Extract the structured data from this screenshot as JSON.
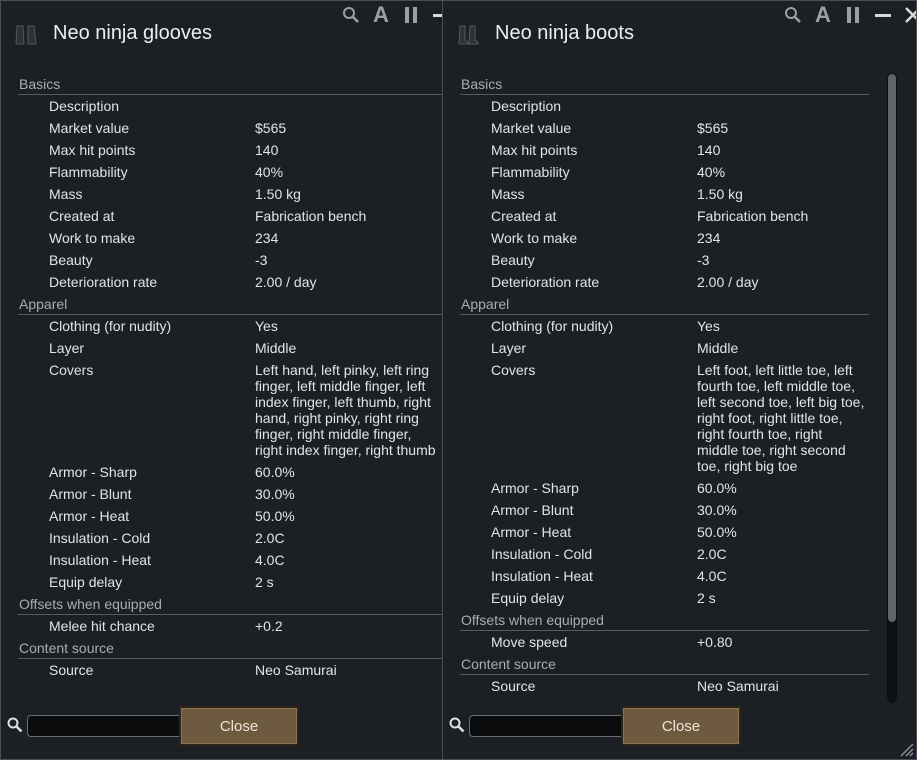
{
  "windows": [
    {
      "title": "Neo ninja glooves",
      "controls": {
        "font_toggle": "A"
      },
      "sections": [
        {
          "header": "Basics",
          "rows": [
            {
              "label": "Description",
              "value": ""
            },
            {
              "label": "Market value",
              "value": "$565"
            },
            {
              "label": "Max hit points",
              "value": "140"
            },
            {
              "label": "Flammability",
              "value": "40%"
            },
            {
              "label": "Mass",
              "value": "1.50 kg"
            },
            {
              "label": "Created at",
              "value": "Fabrication bench"
            },
            {
              "label": "Work to make",
              "value": "234"
            },
            {
              "label": "Beauty",
              "value": "-3"
            },
            {
              "label": "Deterioration rate",
              "value": "2.00 / day"
            }
          ]
        },
        {
          "header": "Apparel",
          "rows": [
            {
              "label": "Clothing (for nudity)",
              "value": "Yes"
            },
            {
              "label": "Layer",
              "value": "Middle"
            },
            {
              "label": "Covers",
              "value": "Left hand, left pinky, left ring finger, left middle finger, left index finger, left thumb, right hand, right pinky, right ring finger, right middle finger, right index finger, right thumb"
            },
            {
              "label": "Armor - Sharp",
              "value": "60.0%"
            },
            {
              "label": "Armor - Blunt",
              "value": "30.0%"
            },
            {
              "label": "Armor - Heat",
              "value": "50.0%"
            },
            {
              "label": "Insulation - Cold",
              "value": "2.0C"
            },
            {
              "label": "Insulation - Heat",
              "value": "4.0C"
            },
            {
              "label": "Equip delay",
              "value": "2 s"
            }
          ]
        },
        {
          "header": "Offsets when equipped",
          "rows": [
            {
              "label": "Melee hit chance",
              "value": "+0.2"
            }
          ]
        },
        {
          "header": "Content source",
          "rows": [
            {
              "label": "Source",
              "value": "Neo Samurai"
            }
          ]
        }
      ],
      "search": {
        "value": "",
        "placeholder": ""
      },
      "close_label": "Close"
    },
    {
      "title": "Neo ninja boots",
      "controls": {
        "font_toggle": "A"
      },
      "sections": [
        {
          "header": "Basics",
          "rows": [
            {
              "label": "Description",
              "value": ""
            },
            {
              "label": "Market value",
              "value": "$565"
            },
            {
              "label": "Max hit points",
              "value": "140"
            },
            {
              "label": "Flammability",
              "value": "40%"
            },
            {
              "label": "Mass",
              "value": "1.50 kg"
            },
            {
              "label": "Created at",
              "value": "Fabrication bench"
            },
            {
              "label": "Work to make",
              "value": "234"
            },
            {
              "label": "Beauty",
              "value": "-3"
            },
            {
              "label": "Deterioration rate",
              "value": "2.00 / day"
            }
          ]
        },
        {
          "header": "Apparel",
          "rows": [
            {
              "label": "Clothing (for nudity)",
              "value": "Yes"
            },
            {
              "label": "Layer",
              "value": "Middle"
            },
            {
              "label": "Covers",
              "value": "Left foot, left little toe, left fourth toe, left middle toe, left second toe, left big toe, right foot, right little toe, right fourth toe, right middle toe, right second toe, right big toe"
            },
            {
              "label": "Armor - Sharp",
              "value": "60.0%"
            },
            {
              "label": "Armor - Blunt",
              "value": "30.0%"
            },
            {
              "label": "Armor - Heat",
              "value": "50.0%"
            },
            {
              "label": "Insulation - Cold",
              "value": "2.0C"
            },
            {
              "label": "Insulation - Heat",
              "value": "4.0C"
            },
            {
              "label": "Equip delay",
              "value": "2 s"
            }
          ]
        },
        {
          "header": "Offsets when equipped",
          "rows": [
            {
              "label": "Move speed",
              "value": "+0.80"
            }
          ]
        },
        {
          "header": "Content source",
          "rows": [
            {
              "label": "Source",
              "value": "Neo Samurai"
            }
          ]
        }
      ],
      "search": {
        "value": "",
        "placeholder": ""
      },
      "close_label": "Close"
    }
  ],
  "icons": {
    "gloves": "gloves-icon",
    "boots": "boots-icon",
    "search": "search-icon",
    "pause": "pause-icon",
    "minimize": "minimize-icon",
    "close": "close-icon",
    "resize": "resize-grip-icon"
  },
  "colors": {
    "window_bg": "#1c2025",
    "button_bg": "#6e5a3e",
    "section_text": "#a9adb2",
    "text": "#e2e4e6"
  }
}
